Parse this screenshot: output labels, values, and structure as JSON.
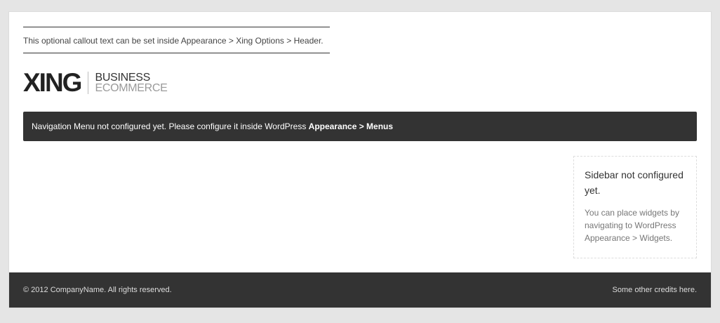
{
  "header": {
    "callout_text": "This optional callout text can be set inside Appearance > Xing Options > Header.",
    "logo": {
      "mark": "XING",
      "line1": "BUSINESS",
      "line2": "ECOMMERCE"
    }
  },
  "nav": {
    "notice_text": "Navigation Menu not configured yet. Please configure it inside WordPress ",
    "notice_link": "Appearance > Menus"
  },
  "sidebar": {
    "title": "Sidebar not configured yet.",
    "text": "You can place widgets by navigating to WordPress Appearance > Widgets."
  },
  "footer": {
    "copyright": "© 2012 CompanyName. All rights reserved.",
    "credits": "Some other credits here."
  },
  "colors": {
    "background": "#e5e5e5",
    "page": "#ffffff",
    "dark_bar": "#333333"
  }
}
